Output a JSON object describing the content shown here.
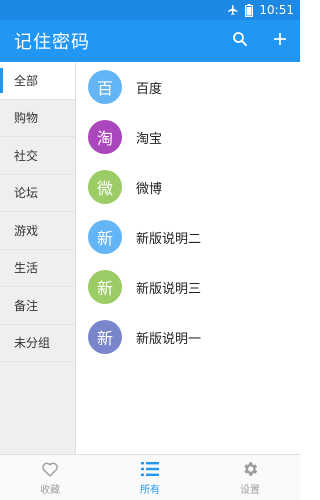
{
  "status_bar": {
    "time": "10:51",
    "airplane_icon": "airplane-icon",
    "battery_icon": "battery-icon"
  },
  "app_bar": {
    "title": "记住密码",
    "search_icon": "search-icon",
    "add_icon": "plus-icon"
  },
  "sidebar": {
    "items": [
      {
        "label": "全部"
      },
      {
        "label": "购物"
      },
      {
        "label": "社交"
      },
      {
        "label": "论坛"
      },
      {
        "label": "游戏"
      },
      {
        "label": "生活"
      },
      {
        "label": "备注"
      },
      {
        "label": "未分组"
      }
    ]
  },
  "list": {
    "items": [
      {
        "avatar": "百",
        "label": "百度",
        "color": "#64b5f6"
      },
      {
        "avatar": "淘",
        "label": "淘宝",
        "color": "#ab47bc"
      },
      {
        "avatar": "微",
        "label": "微博",
        "color": "#9ccc65"
      },
      {
        "avatar": "新",
        "label": "新版说明二",
        "color": "#64b5f6"
      },
      {
        "avatar": "新",
        "label": "新版说明三",
        "color": "#9ccc65"
      },
      {
        "avatar": "新",
        "label": "新版说明一",
        "color": "#7986cb"
      }
    ]
  },
  "bottom_nav": {
    "items": [
      {
        "label": "收藏",
        "icon": "heart-icon"
      },
      {
        "label": "所有",
        "icon": "list-icon"
      },
      {
        "label": "设置",
        "icon": "gear-icon"
      }
    ]
  },
  "colors": {
    "primary": "#2196f3",
    "status_bar": "#1e88e5",
    "inactive": "#9e9e9e"
  }
}
